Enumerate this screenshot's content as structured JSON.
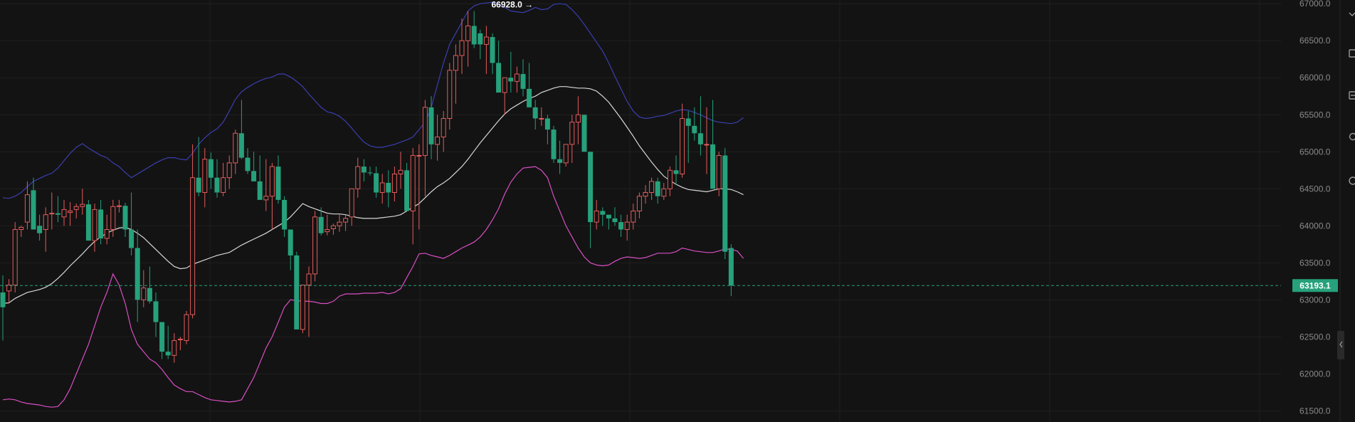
{
  "chart_data": {
    "type": "candlestick",
    "y_axis": {
      "range": [
        61350,
        67050
      ],
      "ticks": [
        61500,
        62000,
        62500,
        63000,
        63500,
        64000,
        64500,
        65000,
        65500,
        66000,
        66500,
        67000
      ],
      "tick_labels": [
        "61500.0",
        "62000.0",
        "62500.0",
        "63000.0",
        "63500.0",
        "64000.0",
        "64500.0",
        "65000.0",
        "65500.0",
        "66000.0",
        "66500.0",
        "67000.0"
      ]
    },
    "grid": true,
    "current_price": 63193.1,
    "current_price_label": "63193.1",
    "high_marker": {
      "bar_index": 87,
      "value": 66928,
      "label": "66928.0 →"
    },
    "colors": {
      "up": "#e45b5b",
      "down": "#26a17b",
      "middle_band": "#d8d8d8",
      "upper_band": "#3b3fb0",
      "lower_band": "#d94fc4",
      "price_line": "#26a17b",
      "background": "#131313",
      "grid": "#1f1f1f"
    },
    "candles": [
      [
        63100,
        63330,
        62450,
        62900
      ],
      [
        63120,
        63280,
        62950,
        63200
      ],
      [
        63200,
        64050,
        63100,
        63950
      ],
      [
        63950,
        64000,
        63850,
        63980
      ],
      [
        64050,
        64600,
        63950,
        64420
      ],
      [
        64480,
        64650,
        64000,
        63950
      ],
      [
        64000,
        64150,
        63800,
        63900
      ],
      [
        63950,
        64250,
        63650,
        64150
      ],
      [
        64160,
        64450,
        63950,
        64170
      ],
      [
        64170,
        64400,
        64050,
        64150
      ],
      [
        64120,
        64350,
        64000,
        64220
      ],
      [
        64180,
        64320,
        64000,
        64200
      ],
      [
        64220,
        64300,
        64100,
        64260
      ],
      [
        64260,
        64500,
        64150,
        64290
      ],
      [
        64290,
        64350,
        63950,
        63800
      ],
      [
        63800,
        64300,
        63650,
        64220
      ],
      [
        64220,
        64350,
        63750,
        63830
      ],
      [
        63830,
        64150,
        63750,
        63950
      ],
      [
        63950,
        64350,
        63850,
        64260
      ],
      [
        64260,
        64350,
        64180,
        64270
      ],
      [
        64270,
        64310,
        63850,
        63950
      ],
      [
        63950,
        64450,
        63600,
        63700
      ],
      [
        63700,
        63950,
        62700,
        63000
      ],
      [
        63000,
        63400,
        62900,
        63160
      ],
      [
        63160,
        63450,
        62950,
        62980
      ],
      [
        62980,
        63100,
        62500,
        62700
      ],
      [
        62700,
        62500,
        62200,
        62300
      ],
      [
        62300,
        62650,
        62200,
        62250
      ],
      [
        62250,
        62550,
        62150,
        62450
      ],
      [
        62460,
        62500,
        62320,
        62470
      ],
      [
        62450,
        62850,
        62400,
        62800
      ],
      [
        62800,
        65100,
        62750,
        64650
      ],
      [
        64650,
        65200,
        64400,
        64450
      ],
      [
        64450,
        65050,
        64250,
        64900
      ],
      [
        64900,
        64990,
        64500,
        64650
      ],
      [
        64650,
        64900,
        64380,
        64450
      ],
      [
        64450,
        64850,
        64400,
        64650
      ],
      [
        64650,
        64950,
        64500,
        64850
      ],
      [
        64850,
        65300,
        64700,
        65250
      ],
      [
        65250,
        65700,
        64900,
        64920
      ],
      [
        64920,
        65050,
        64700,
        64740
      ],
      [
        64740,
        65000,
        64650,
        64600
      ],
      [
        64600,
        64950,
        64450,
        64350
      ],
      [
        64350,
        64900,
        64200,
        64400
      ],
      [
        64400,
        64850,
        63950,
        64800
      ],
      [
        64800,
        64950,
        64300,
        64350
      ],
      [
        64350,
        64400,
        63850,
        63950
      ],
      [
        63950,
        63900,
        63400,
        63600
      ],
      [
        63600,
        63650,
        62600,
        62600
      ],
      [
        62600,
        63100,
        62550,
        63200
      ],
      [
        63200,
        63450,
        62500,
        63350
      ],
      [
        63350,
        64200,
        63250,
        64120
      ],
      [
        64120,
        64250,
        63870,
        63900
      ],
      [
        63920,
        64150,
        63870,
        63950
      ],
      [
        63960,
        64030,
        63880,
        64000
      ],
      [
        64000,
        64150,
        63920,
        64050
      ],
      [
        64050,
        64150,
        63930,
        64100
      ],
      [
        64120,
        64450,
        64000,
        64500
      ],
      [
        64500,
        64920,
        64380,
        64800
      ],
      [
        64800,
        64900,
        64600,
        64720
      ],
      [
        64720,
        64800,
        64680,
        64710
      ],
      [
        64710,
        64800,
        64380,
        64450
      ],
      [
        64450,
        64700,
        64300,
        64580
      ],
      [
        64580,
        64750,
        64250,
        64450
      ],
      [
        64450,
        64800,
        64330,
        64700
      ],
      [
        64700,
        65000,
        64500,
        64750
      ],
      [
        64750,
        64850,
        64350,
        64200
      ],
      [
        64200,
        65050,
        63750,
        64950
      ],
      [
        64950,
        65100,
        63950,
        64950
      ],
      [
        64950,
        65700,
        64400,
        65600
      ],
      [
        65600,
        65750,
        64900,
        65100
      ],
      [
        65100,
        65500,
        64880,
        65200
      ],
      [
        65200,
        65550,
        65000,
        65450
      ],
      [
        65450,
        66200,
        65300,
        66100
      ],
      [
        66100,
        66450,
        65650,
        66300
      ],
      [
        66300,
        66800,
        66050,
        66500
      ],
      [
        66500,
        66900,
        66150,
        66700
      ],
      [
        66700,
        66900,
        66400,
        66450
      ],
      [
        66600,
        66650,
        66250,
        66450
      ],
      [
        66450,
        66700,
        66050,
        66550
      ],
      [
        66550,
        66600,
        66050,
        66200
      ],
      [
        66200,
        66500,
        65800,
        65800
      ],
      [
        65800,
        65900,
        65500,
        66000
      ],
      [
        66000,
        66350,
        65800,
        65950
      ],
      [
        65950,
        66150,
        65800,
        66050
      ],
      [
        66050,
        66250,
        65750,
        65850
      ],
      [
        65850,
        66200,
        65600,
        65600
      ],
      [
        65600,
        65700,
        65300,
        65450
      ],
      [
        65450,
        65600,
        65350,
        65450
      ],
      [
        65450,
        65500,
        65100,
        65300
      ],
      [
        65300,
        65350,
        64850,
        64900
      ],
      [
        64900,
        65150,
        64700,
        64850
      ],
      [
        64850,
        65100,
        64800,
        65100
      ],
      [
        65100,
        65500,
        64850,
        65400
      ],
      [
        65400,
        65750,
        65100,
        65500
      ],
      [
        65500,
        65500,
        65200,
        65000
      ],
      [
        65000,
        65000,
        63700,
        64050
      ],
      [
        64050,
        64350,
        63950,
        64200
      ],
      [
        64200,
        64250,
        64000,
        64150
      ],
      [
        64150,
        64150,
        63950,
        64100
      ],
      [
        64100,
        64250,
        64000,
        64050
      ],
      [
        64050,
        64150,
        63850,
        63950
      ],
      [
        63950,
        64150,
        63800,
        64050
      ],
      [
        64050,
        64300,
        63950,
        64200
      ],
      [
        64200,
        64450,
        64100,
        64400
      ],
      [
        64400,
        64550,
        64300,
        64450
      ],
      [
        64450,
        64650,
        64350,
        64600
      ],
      [
        64600,
        64650,
        64300,
        64400
      ],
      [
        64400,
        64580,
        64350,
        64500
      ],
      [
        64500,
        64800,
        64400,
        64750
      ],
      [
        64750,
        64950,
        64550,
        64700
      ],
      [
        64700,
        65650,
        64650,
        65450
      ],
      [
        65450,
        65550,
        64850,
        65350
      ],
      [
        65350,
        65600,
        65150,
        65250
      ],
      [
        65250,
        65750,
        64950,
        65100
      ],
      [
        65100,
        65600,
        64700,
        65100
      ],
      [
        65100,
        65700,
        64550,
        64500
      ],
      [
        64500,
        65000,
        64400,
        64950
      ],
      [
        64950,
        65050,
        63550,
        63650
      ],
      [
        63700,
        63750,
        63050,
        63193.1
      ]
    ],
    "middle_band": [
      62950,
      62960,
      63020,
      63060,
      63100,
      63120,
      63140,
      63170,
      63220,
      63290,
      63370,
      63460,
      63540,
      63620,
      63710,
      63790,
      63850,
      63900,
      63940,
      63970,
      63980,
      63950,
      63900,
      63840,
      63760,
      63680,
      63600,
      63520,
      63450,
      63420,
      63430,
      63480,
      63510,
      63540,
      63570,
      63600,
      63620,
      63640,
      63690,
      63740,
      63780,
      63820,
      63860,
      63900,
      63950,
      64000,
      64050,
      64120,
      64210,
      64300,
      64260,
      64230,
      64200,
      64170,
      64160,
      64160,
      64150,
      64130,
      64110,
      64100,
      64100,
      64100,
      64110,
      64120,
      64130,
      64150,
      64200,
      64250,
      64300,
      64380,
      64460,
      64530,
      64580,
      64640,
      64720,
      64800,
      64900,
      65010,
      65120,
      65220,
      65320,
      65420,
      65510,
      65580,
      65630,
      65680,
      65720,
      65750,
      65800,
      65830,
      65860,
      65880,
      65880,
      65870,
      65860,
      65860,
      65850,
      65820,
      65750,
      65670,
      65560,
      65450,
      65330,
      65210,
      65080,
      64970,
      64860,
      64760,
      64670,
      64610,
      64560,
      64520,
      64490,
      64480,
      64470,
      64460,
      64480,
      64500,
      64500,
      64490,
      64460,
      64420
    ],
    "upper_band": [
      64380,
      64370,
      64400,
      64450,
      64530,
      64600,
      64640,
      64680,
      64710,
      64780,
      64880,
      64980,
      65060,
      65110,
      65050,
      65000,
      64950,
      64920,
      64850,
      64800,
      64720,
      64650,
      64700,
      64750,
      64800,
      64850,
      64890,
      64920,
      64920,
      64900,
      64890,
      64980,
      65100,
      65190,
      65260,
      65310,
      65400,
      65550,
      65710,
      65810,
      65870,
      65920,
      65960,
      65990,
      66010,
      66050,
      66050,
      66010,
      65950,
      65880,
      65780,
      65690,
      65600,
      65540,
      65520,
      65480,
      65410,
      65320,
      65220,
      65130,
      65080,
      65060,
      65060,
      65080,
      65100,
      65130,
      65160,
      65200,
      65300,
      65400,
      65600,
      65900,
      66200,
      66450,
      66600,
      66750,
      66900,
      66970,
      67000,
      67010,
      67020,
      66990,
      66950,
      66900,
      66890,
      66880,
      66910,
      66950,
      66920,
      66930,
      66990,
      67000,
      66990,
      66920,
      66830,
      66720,
      66600,
      66480,
      66360,
      66200,
      66020,
      65850,
      65680,
      65550,
      65470,
      65450,
      65460,
      65480,
      65490,
      65520,
      65550,
      65570,
      65560,
      65530,
      65500,
      65460,
      65420,
      65400,
      65390,
      65380,
      65400,
      65460
    ],
    "lower_band": [
      61650,
      61660,
      61650,
      61620,
      61600,
      61590,
      61580,
      61560,
      61550,
      61560,
      61650,
      61800,
      62000,
      62200,
      62400,
      62650,
      62900,
      63100,
      63350,
      63200,
      62950,
      62600,
      62400,
      62300,
      62200,
      62150,
      62060,
      61950,
      61850,
      61800,
      61760,
      61760,
      61720,
      61680,
      61650,
      61640,
      61630,
      61620,
      61630,
      61650,
      61800,
      61950,
      62150,
      62350,
      62500,
      62700,
      62900,
      63000,
      62990,
      62980,
      62980,
      62970,
      62950,
      62950,
      62980,
      63050,
      63080,
      63080,
      63080,
      63090,
      63090,
      63090,
      63100,
      63080,
      63100,
      63150,
      63300,
      63450,
      63620,
      63630,
      63600,
      63580,
      63560,
      63600,
      63650,
      63700,
      63740,
      63780,
      63850,
      63950,
      64080,
      64230,
      64430,
      64590,
      64700,
      64780,
      64790,
      64800,
      64750,
      64650,
      64400,
      64200,
      64000,
      63850,
      63700,
      63580,
      63500,
      63470,
      63460,
      63470,
      63520,
      63560,
      63580,
      63570,
      63560,
      63570,
      63600,
      63630,
      63630,
      63630,
      63650,
      63700,
      63680,
      63660,
      63650,
      63640,
      63640,
      63660,
      63690,
      63680,
      63660,
      63560
    ]
  }
}
